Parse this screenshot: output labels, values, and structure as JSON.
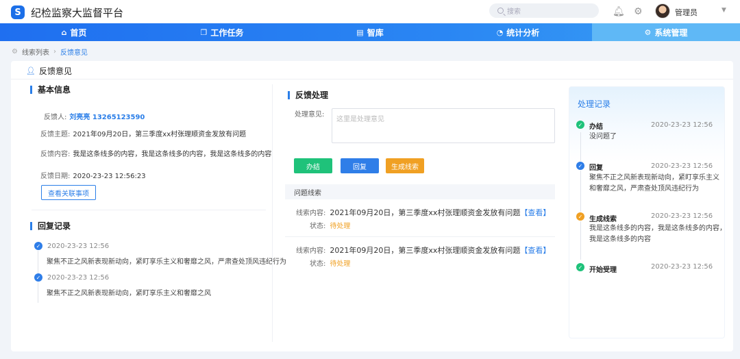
{
  "app": {
    "logo_letter": "S",
    "title": "纪检监察大监督平台"
  },
  "header": {
    "search_placeholder": "搜索",
    "username": "管理员"
  },
  "nav": [
    {
      "label": "首页",
      "icon": "home-icon",
      "active": false
    },
    {
      "label": "工作任务",
      "icon": "task-icon",
      "active": false
    },
    {
      "label": "智库",
      "icon": "library-icon",
      "active": false
    },
    {
      "label": "统计分析",
      "icon": "pie-chart-icon",
      "active": false
    },
    {
      "label": "系统管理",
      "icon": "gear-icon",
      "active": true
    }
  ],
  "breadcrumb": {
    "parent": "线索列表",
    "current": "反馈意见"
  },
  "page_title": "反馈意见",
  "basic_info": {
    "heading": "基本信息",
    "person_label": "反馈人:",
    "person_value": "刘亮亮 13265123590",
    "topic_label": "反馈主题:",
    "topic_value": "2021年09月20日，第三季度xx村张理顺资金发放有问题",
    "content_label": "反馈内容:",
    "content_value": "我是这条线多的内容，我是这条线多的内容，我是这条线多的内容",
    "date_label": "反馈日期:",
    "date_value": "2020-23-23  12:56:23",
    "related_button": "查看关联事项"
  },
  "reply_records": {
    "heading": "回复记录",
    "items": [
      {
        "time": "2020-23-23  12:56",
        "text": "聚焦不正之风新表现新动向，紧盯享乐主义和奢靡之风，严肃查处顶风违纪行为"
      },
      {
        "time": "2020-23-23  12:56",
        "text": "聚焦不正之风新表现新动向，紧盯享乐主义和奢靡之风"
      }
    ]
  },
  "feedback_processing": {
    "heading": "反馈处理",
    "opinion_label": "处理意见:",
    "opinion_placeholder": "这里是处理意见",
    "buttons": {
      "finish": "办结",
      "reply": "回复",
      "generate": "生成线索"
    },
    "issue_header": "问题线索",
    "issues": [
      {
        "content_label": "线索内容:",
        "content": "2021年09月20日，第三季度xx村张理顺资金发放有问题",
        "link": "【查看】",
        "status_label": "状态:",
        "status": "待处理"
      },
      {
        "content_label": "线索内容:",
        "content": "2021年09月20日，第三季度xx村张理顺资金发放有问题",
        "link": "【查看】",
        "status_label": "状态:",
        "status": "待处理"
      }
    ]
  },
  "process_records": {
    "heading": "处理记录",
    "items": [
      {
        "title": "办结",
        "time": "2020-23-23  12:56",
        "lines": [
          "没问题了"
        ],
        "color": "#1fc27a"
      },
      {
        "title": "回复",
        "time": "2020-23-23  12:56",
        "lines": [
          "聚焦不正之风新表现新动向，紧盯享乐主义",
          "和奢靡之风，严肃查处顶风违纪行为"
        ],
        "color": "#2f7ee8"
      },
      {
        "title": "生成线索",
        "time": "2020-23-23  12:56",
        "lines": [
          "我是这条线多的内容，我是这条线多的内容，",
          "我是这条线多的内容"
        ],
        "color": "#f0a023"
      },
      {
        "title": "开始受理",
        "time": "2020-23-23  12:56",
        "lines": [],
        "color": "#1fc27a"
      }
    ]
  },
  "colors": {
    "primary": "#2a7ee8",
    "success": "#1fc27a",
    "warning": "#f0a023"
  }
}
